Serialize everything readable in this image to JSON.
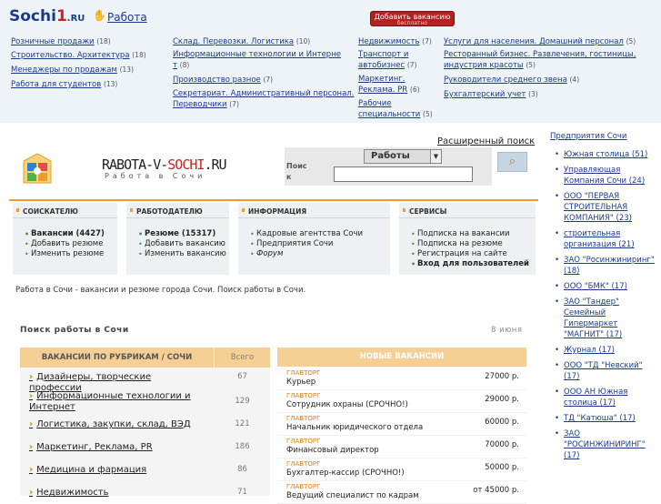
{
  "topbar": {
    "logo_text": "Sochi",
    "logo_one": "1",
    "logo_ru": ".RU",
    "section_link": "Работа",
    "add_vacancy": "Добавить вакансию",
    "add_vacancy_sub": "бесплатно"
  },
  "top_categories": [
    {
      "label": "Розничные продажи",
      "count": "(18)"
    },
    {
      "label": "Строительство. Архитектура",
      "count": "(18)"
    },
    {
      "label": "Менеджеры по продажам",
      "count": "(13)"
    },
    {
      "label": "Работа для студентов",
      "count": "(13)"
    },
    {
      "label": "Склад. Перевозки. Логистика",
      "count": "(10)"
    },
    {
      "label": "Информационные технологии и Интерне т",
      "count": "(8)"
    },
    {
      "label": "Производство разное",
      "count": "(7)"
    },
    {
      "label": "Секретариат. Административный персонал. Переводчики",
      "count": "(7)"
    },
    {
      "label": "Недвижимость",
      "count": "(7)"
    },
    {
      "label": "Транспорт и автобизнес",
      "count": "(7)"
    },
    {
      "label": "Маркетинг. Реклама. PR",
      "count": "(6)"
    },
    {
      "label": "Рабочие специальности",
      "count": "(5)"
    },
    {
      "label": "Услуги для населения. Домашний персонал",
      "count": "(5)"
    },
    {
      "label": "Ресторанный бизнес. Развлечения, гостиницы, индустрия красоты",
      "count": "(5)"
    },
    {
      "label": "Руководители среднего звена",
      "count": "(4)"
    },
    {
      "label": "Бухгалтерский учет",
      "count": "(3)"
    }
  ],
  "site": {
    "name_a": "RABOTA-V-",
    "name_b": "SOCHI",
    "name_c": ".RU",
    "slogan": "Работа в Сочи"
  },
  "search": {
    "advanced": "Расширенный поиск",
    "label": "Поис к",
    "selected": "Работы",
    "value": ""
  },
  "boxes": [
    {
      "title": "СОИСКАТЕЛЮ",
      "items": [
        "Вакансии (4427)",
        "Добавить резюме",
        "Изменить резюме"
      ]
    },
    {
      "title": "РАБОТОДАТЕЛЮ",
      "items": [
        "Резюме (15317)",
        "Добавить вакансию",
        "Изменить вакансию"
      ]
    },
    {
      "title": "ИНФОРМАЦИЯ",
      "items": [
        "Кадровые агентства Сочи",
        "Предприятия Сочи",
        "Форум"
      ]
    },
    {
      "title": "СЕРВИСЫ",
      "items": [
        "Подписка на вакансии",
        "Подписка на резюме",
        "Регистрация на сайте",
        "Вход для пользователей"
      ]
    }
  ],
  "intro": "Работа в Сочи - вакансии и резюме города Сочи. Поиск работы в Сочи.",
  "search_block": {
    "title": "Поиск работы в Сочи",
    "date": "8 июня"
  },
  "rubrics": {
    "header": "ВАКАНСИИ ПО РУБРИКАМ / СОЧИ",
    "header_total": "Всего",
    "rows": [
      {
        "name": "Дизайнеры, творческие профессии",
        "count": "67"
      },
      {
        "name": "Информационные технологии и Интернет",
        "count": "129"
      },
      {
        "name": "Логистика, закупки, склад, ВЭД",
        "count": "121"
      },
      {
        "name": "Маркетинг, Реклама, PR",
        "count": "186"
      },
      {
        "name": "Медицина и фармация",
        "count": "86"
      },
      {
        "name": "Недвижимость",
        "count": "71"
      }
    ]
  },
  "new_vacancies": {
    "header": "НОВЫЕ ВАКАНСИИ",
    "rows": [
      {
        "company": "ГЛАВТОРГ",
        "title": "Курьер",
        "salary": "27000 р."
      },
      {
        "company": "ГЛАВТОРГ",
        "title": "Сотрудник охраны (СРОЧНО!)",
        "salary": "29000 р."
      },
      {
        "company": "ГЛАВТОРГ",
        "title": "Начальник юридического отдела",
        "salary": "60000 р."
      },
      {
        "company": "ГЛАВТОРГ",
        "title": "Финансовый директор",
        "salary": "70000 р."
      },
      {
        "company": "ГЛАВТОРГ",
        "title": "Бухгалтер-кассир (СРОЧНО!)",
        "salary": "50000 р."
      },
      {
        "company": "ГЛАВТОРГ",
        "title": "Ведущий специалист по кадрам",
        "salary": "от 45000 р."
      }
    ]
  },
  "sidebar": {
    "title": "Предприятия Сочи",
    "items": [
      "Южная столица (51)",
      "Управляющая Компания Сочи (24)",
      "ООО \"ПЕРВАЯ СТРОИТЕЛЬНАЯ КОМПАНИЯ\" (23)",
      "строительная организация (21)",
      "ЗАО \"Росинжиниринг\" (18)",
      "ООО \"БМК\" (17)",
      "ЗАО \"Тандер\" Семейный Гипермаркет \"МАГНИТ\" (17)",
      "Журнал (17)",
      "ООО \"ТД \"Невский\" (17)",
      "ООО АН Южная столица (17)",
      "ТД \"Катюша\" (17)",
      "ЗАО \"РОСИНЖИНИРИНГ\" (17)"
    ]
  },
  "colors": {
    "accent": "#f29a2e",
    "link": "#1a3a8f",
    "button": "#b52020"
  }
}
